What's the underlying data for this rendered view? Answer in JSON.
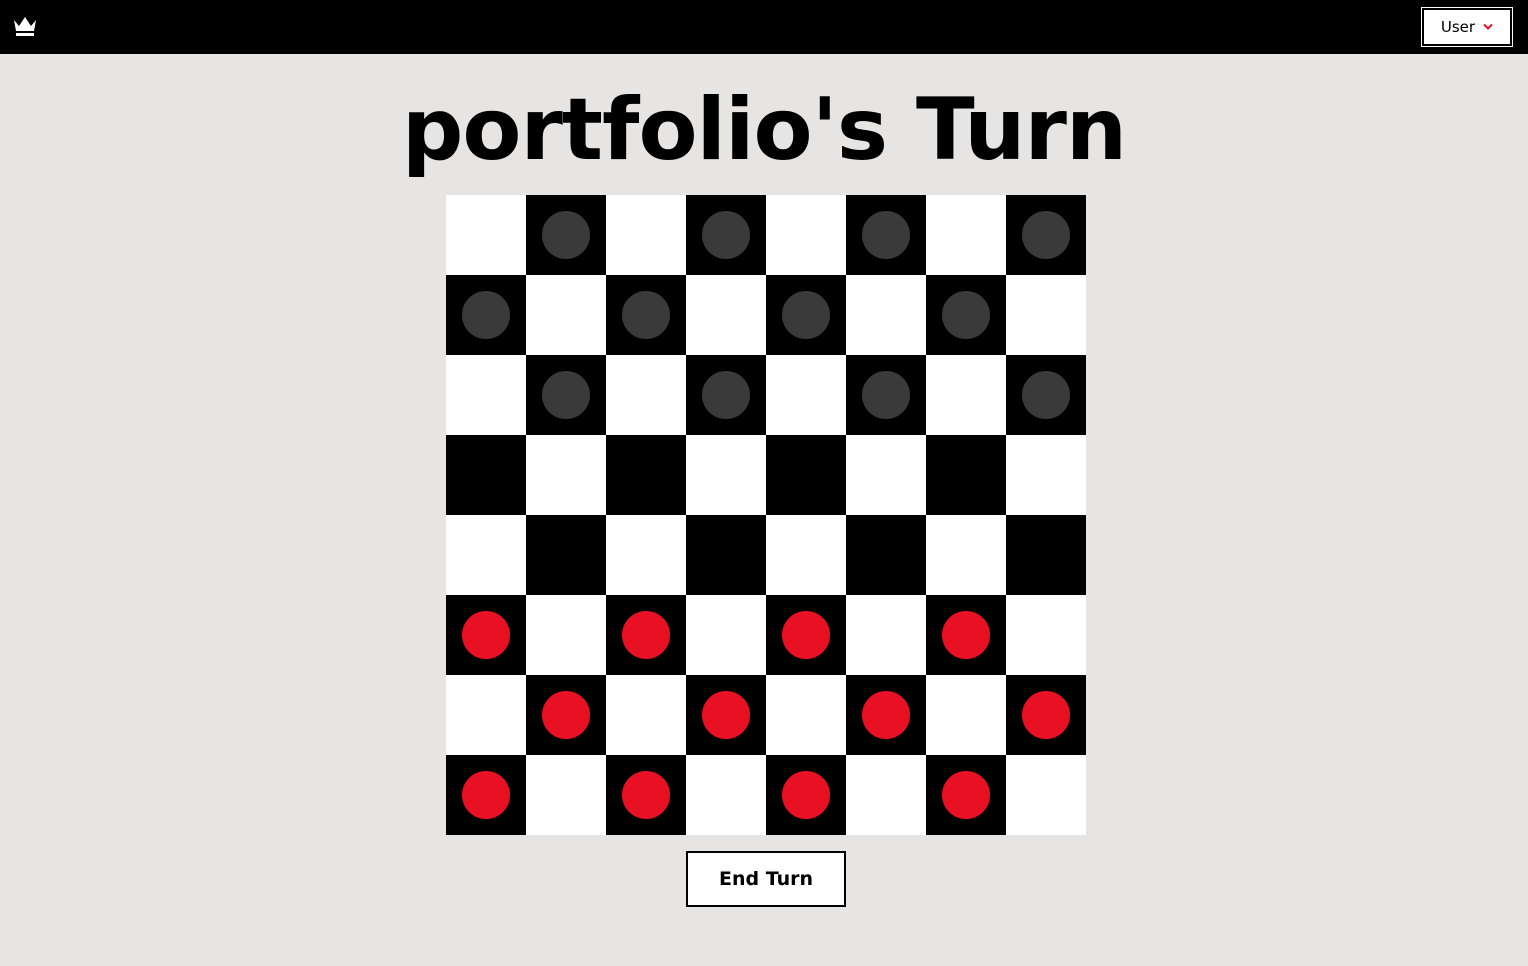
{
  "header": {
    "logo_icon": "crown-icon",
    "user_menu_label": "User",
    "user_menu_icon": "chevron-down-icon",
    "accent_color": "#e81123"
  },
  "title": "portfolio's Turn",
  "board": {
    "size": 8,
    "colors": {
      "light_square": "#ffffff",
      "dark_square": "#000000",
      "black_piece": "#3a3a3a",
      "red_piece": "#e81123"
    },
    "rows": [
      [
        "",
        "b",
        "",
        "b",
        "",
        "b",
        "",
        "b"
      ],
      [
        "b",
        "",
        "b",
        "",
        "b",
        "",
        "b",
        ""
      ],
      [
        "",
        "b",
        "",
        "b",
        "",
        "b",
        "",
        "b"
      ],
      [
        "",
        "",
        "",
        "",
        "",
        "",
        "",
        ""
      ],
      [
        "",
        "",
        "",
        "",
        "",
        "",
        "",
        ""
      ],
      [
        "r",
        "",
        "r",
        "",
        "r",
        "",
        "r",
        ""
      ],
      [
        "",
        "r",
        "",
        "r",
        "",
        "r",
        "",
        "r"
      ],
      [
        "r",
        "",
        "r",
        "",
        "r",
        "",
        "r",
        ""
      ]
    ]
  },
  "actions": {
    "end_turn_label": "End Turn"
  }
}
